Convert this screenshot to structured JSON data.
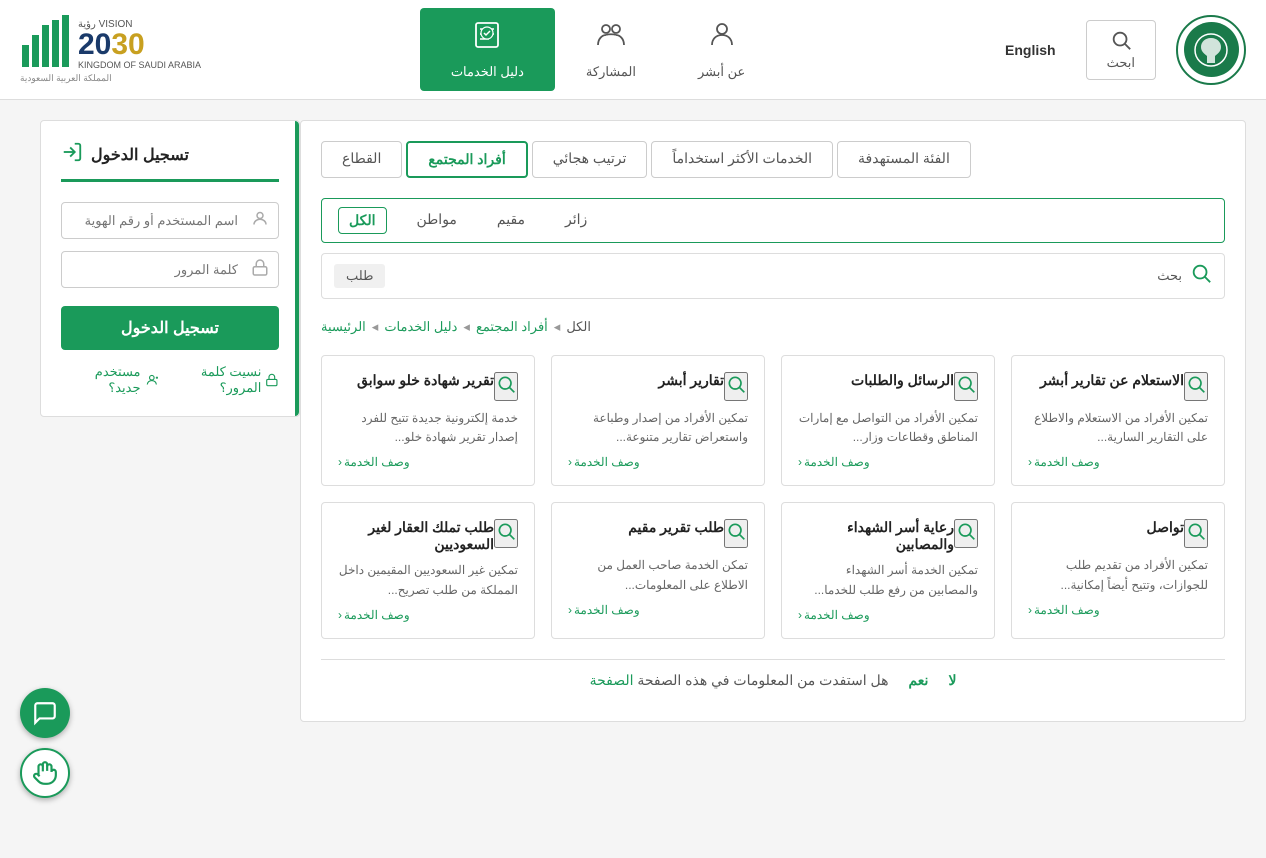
{
  "header": {
    "logo_alt": "Saudi Arabia Logo",
    "search_label": "ابحث",
    "lang_label": "English",
    "nav_items": [
      {
        "id": "about",
        "label": "عن أبشر",
        "icon": "👤"
      },
      {
        "id": "participation",
        "label": "المشاركة",
        "icon": "👥"
      },
      {
        "id": "services",
        "label": "دليل الخدمات",
        "icon": "📖",
        "active": true
      }
    ],
    "vision_year": "2030",
    "vision_label": "رؤية",
    "vision_sub": "المملكة العربية السعودية",
    "vision_sub2": "KINGDOM OF SAUDI ARABIA"
  },
  "sidebar": {
    "login_title": "تسجيل الدخول",
    "username_placeholder": "اسم المستخدم أو رقم الهوية",
    "password_placeholder": "كلمة المرور",
    "login_btn": "تسجيل الدخول",
    "new_user_label": "مستخدم جديد؟",
    "forgot_password_label": "نسيت كلمة المرور؟"
  },
  "tabs": [
    {
      "id": "sector",
      "label": "القطاع",
      "active": false
    },
    {
      "id": "society",
      "label": "أفراد المجتمع",
      "active": true
    },
    {
      "id": "sort",
      "label": "ترتيب هجائي",
      "active": false
    },
    {
      "id": "popular",
      "label": "الخدمات الأكثر استخداماً",
      "active": false
    },
    {
      "id": "category",
      "label": "الفئة المستهدفة",
      "active": false
    }
  ],
  "filters": [
    {
      "id": "all",
      "label": "الكل",
      "active": true
    },
    {
      "id": "citizen",
      "label": "مواطن",
      "active": false
    },
    {
      "id": "resident",
      "label": "مقيم",
      "active": false
    },
    {
      "id": "visitor",
      "label": "زائر",
      "active": false
    }
  ],
  "search": {
    "placeholder": "",
    "search_label": "بحث",
    "request_label": "طلب"
  },
  "breadcrumb": [
    {
      "label": "الرئيسية"
    },
    {
      "label": "دليل الخدمات"
    },
    {
      "label": "أفراد المجتمع"
    },
    {
      "label": "الكل"
    }
  ],
  "cards": [
    {
      "title": "الاستعلام عن تقارير أبشر",
      "desc": "تمكين الأفراد من الاستعلام والاطلاع على التقارير السارية...",
      "link": "وصف الخدمة"
    },
    {
      "title": "الرسائل والطلبات",
      "desc": "تمكين الأفراد من التواصل مع إمارات المناطق وقطاعات وزار...",
      "link": "وصف الخدمة"
    },
    {
      "title": "تقارير أبشر",
      "desc": "تمكين الأفراد من إصدار وطباعة واستعراض تقارير متنوعة...",
      "link": "وصف الخدمة"
    },
    {
      "title": "تقرير شهادة خلو سوابق",
      "desc": "خدمة إلكترونية جديدة تتيح للفرد إصدار تقرير شهادة خلو...",
      "link": "وصف الخدمة"
    },
    {
      "title": "تواصل",
      "desc": "تمكين الأفراد من تقديم طلب للجوازات، وتتيح أيضاً إمكانية...",
      "link": "وصف الخدمة"
    },
    {
      "title": "رعاية أسر الشهداء والمصابين",
      "desc": "تمكين الخدمة أسر الشهداء والمصابين من رفع طلب للخدما...",
      "link": "وصف الخدمة"
    },
    {
      "title": "طلب تقرير مقيم",
      "desc": "تمكن الخدمة صاحب العمل من الاطلاع على المعلومات...",
      "link": "وصف الخدمة"
    },
    {
      "title": "طلب تملك العقار لغير السعوديين",
      "desc": "تمكين غير السعوديين المقيمين داخل المملكة من طلب تصريح...",
      "link": "وصف الخدمة"
    }
  ],
  "bottom": {
    "question": "هل استفدت من المعلومات في هذه الصفحة",
    "yes": "نعم",
    "no": "لا"
  },
  "float": {
    "chat_icon": "💬",
    "help_icon": "🤚"
  }
}
